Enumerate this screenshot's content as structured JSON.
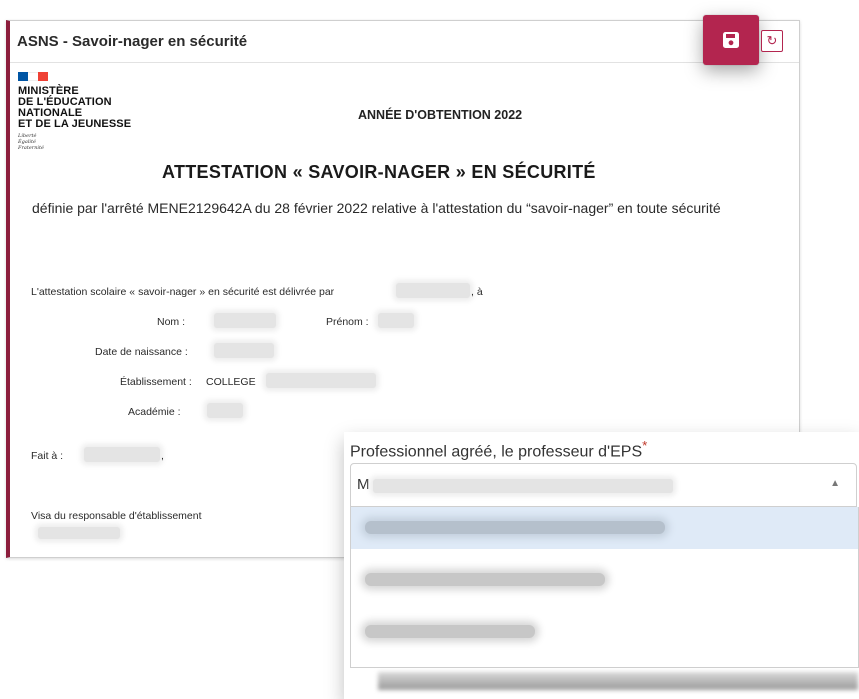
{
  "panel": {
    "title": "ASNS - Savoir-nager en sécurité",
    "save_icon": "floppy-disk-icon",
    "undo_icon": "undo-icon",
    "undo_glyph": "↻"
  },
  "logo": {
    "line1": "MINISTÈRE",
    "line2": "DE L'ÉDUCATION",
    "line3": "NATIONALE",
    "line4": "ET DE LA JEUNESSE",
    "motto1": "Liberté",
    "motto2": "Égalité",
    "motto3": "Fraternité",
    "flag_colors": [
      "#0055a4",
      "#ffffff",
      "#ef4135"
    ]
  },
  "document": {
    "year_label": "ANNÉE D'OBTENTION 2022",
    "title": "ATTESTATION « SAVOIR-NAGER » EN SÉCURITÉ",
    "subtitle": "définie par l'arrêté MENE2129642A du 28 février 2022 relative à l'attestation du “savoir-nager” en toute sécurité",
    "delivered_by": "L'attestation scolaire « savoir-nager » en sécurité est délivrée par",
    "delivered_suffix": ", à",
    "nom_label": "Nom :",
    "prenom_label": "Prénom :",
    "dob_label": "Date de naissance :",
    "school_label": "Établissement :",
    "school_value": "COLLEGE",
    "academy_label": "Académie :",
    "place_label": "Fait à :",
    "place_suffix": ",",
    "visa_label": "Visa du responsable d'établissement"
  },
  "dropdown": {
    "label": "Professionnel agréé, le professeur d'EPS",
    "required_mark": "*",
    "selected_initial": "M",
    "caret": "▲",
    "options_count": 3,
    "active_index": 0
  },
  "colors": {
    "accent": "#b3254f",
    "panel_border": "#8c1d3c",
    "highlight": "#dfeaf7"
  }
}
